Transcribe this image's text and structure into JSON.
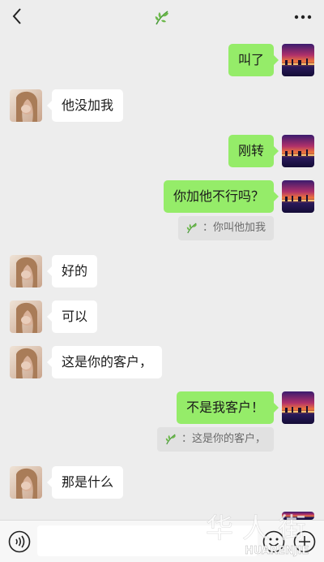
{
  "header": {
    "left_icon": "back-chevron-icon",
    "center_icon": "leaf-icon",
    "right_icon": "more-dots-icon"
  },
  "messages": [
    {
      "side": "out",
      "text": "叫了"
    },
    {
      "side": "in",
      "text": "他没加我"
    },
    {
      "side": "out",
      "text": "刚转"
    },
    {
      "side": "out",
      "text": "你加他不行吗？"
    },
    {
      "side": "quote",
      "text": "：你叫他加我"
    },
    {
      "side": "in",
      "text": "好的"
    },
    {
      "side": "in",
      "text": "可以"
    },
    {
      "side": "in",
      "text": "这是你的客户，"
    },
    {
      "side": "out",
      "text": "不是我客户！"
    },
    {
      "side": "quote",
      "text": "：这是你的客户，"
    },
    {
      "side": "in",
      "text": "那是什么"
    }
  ],
  "bottombar": {
    "input_value": "",
    "icons": [
      "voice-icon",
      "emoji-icon",
      "plus-icon"
    ]
  },
  "watermark": {
    "text": "HUARENJIE",
    "glyph": "华人街"
  },
  "colors": {
    "background": "#ededed",
    "outgoing_bubble": "#95ec69",
    "incoming_bubble": "#ffffff"
  }
}
